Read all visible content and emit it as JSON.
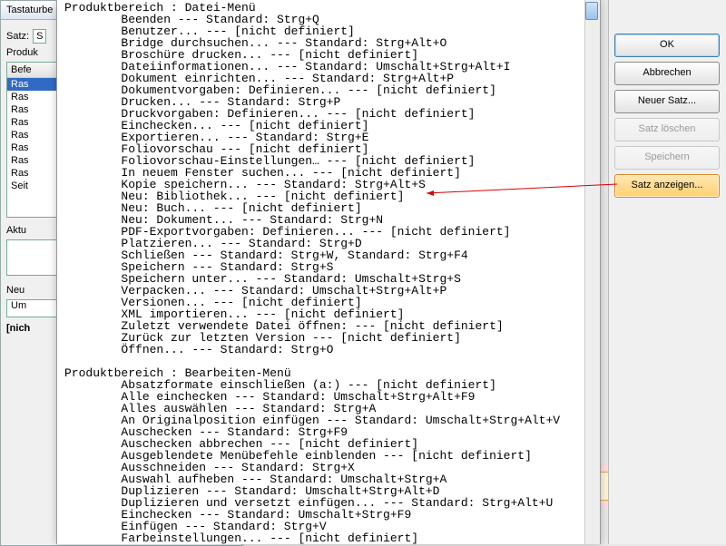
{
  "bg": {
    "title": "Tastaturbe",
    "satz_label": "Satz:",
    "satz_value": "S",
    "produkt_label": "Produk",
    "list_header": "Befe",
    "list_items": [
      "Ras",
      "Ras",
      "Ras",
      "Ras",
      "Ras",
      "Ras",
      "Ras",
      "Ras",
      "Seit"
    ],
    "aktu_label": "Aktu",
    "neu_label": "Neu",
    "um_value": "Um",
    "nicht": "[nich"
  },
  "sections": [
    {
      "title": "Produktbereich : Datei-Menü",
      "items": [
        "Beenden --- Standard: Strg+Q",
        "Benutzer... --- [nicht definiert]",
        "Bridge durchsuchen... --- Standard: Strg+Alt+O",
        "Broschüre drucken... --- [nicht definiert]",
        "Dateiinformationen... --- Standard: Umschalt+Strg+Alt+I",
        "Dokument einrichten... --- Standard: Strg+Alt+P",
        "Dokumentvorgaben: Definieren... --- [nicht definiert]",
        "Drucken... --- Standard: Strg+P",
        "Druckvorgaben: Definieren... --- [nicht definiert]",
        "Einchecken... --- [nicht definiert]",
        "Exportieren... --- Standard: Strg+E",
        "Foliovorschau --- [nicht definiert]",
        "Foliovorschau-Einstellungen… --- [nicht definiert]",
        "In neuem Fenster suchen... --- [nicht definiert]",
        "Kopie speichern... --- Standard: Strg+Alt+S",
        "Neu: Bibliothek... --- [nicht definiert]",
        "Neu: Buch... --- [nicht definiert]",
        "Neu: Dokument... --- Standard: Strg+N",
        "PDF-Exportvorgaben: Definieren... --- [nicht definiert]",
        "Platzieren... --- Standard: Strg+D",
        "Schließen --- Standard: Strg+W, Standard: Strg+F4",
        "Speichern --- Standard: Strg+S",
        "Speichern unter... --- Standard: Umschalt+Strg+S",
        "Verpacken... --- Standard: Umschalt+Strg+Alt+P",
        "Versionen... --- [nicht definiert]",
        "XML importieren... --- [nicht definiert]",
        "Zuletzt verwendete Datei öffnen: --- [nicht definiert]",
        "Zurück zur letzten Version --- [nicht definiert]",
        "Öffnen... --- Standard: Strg+O"
      ]
    },
    {
      "title": "Produktbereich : Bearbeiten-Menü",
      "items": [
        "Absatzformate einschließen (a:) --- [nicht definiert]",
        "Alle einchecken --- Standard: Umschalt+Strg+Alt+F9",
        "Alles auswählen --- Standard: Strg+A",
        "An Originalposition einfügen --- Standard: Umschalt+Strg+Alt+V",
        "Auschecken --- Standard: Strg+F9",
        "Auschecken abbrechen --- [nicht definiert]",
        "Ausgeblendete Menübefehle einblenden --- [nicht definiert]",
        "Ausschneiden --- Standard: Strg+X",
        "Auswahl aufheben --- Standard: Umschalt+Strg+A",
        "Duplizieren --- Standard: Umschalt+Strg+Alt+D",
        "Duplizieren und versetzt einfügen... --- Standard: Strg+Alt+U",
        "Einchecken --- Standard: Umschalt+Strg+F9",
        "Einfügen --- Standard: Strg+V",
        "Farbeinstellungen... --- [nicht definiert]"
      ]
    }
  ],
  "panel": {
    "ok": "OK",
    "abbrechen": "Abbrechen",
    "neuer_satz": "Neuer Satz...",
    "satz_loeschen": "Satz löschen",
    "speichern": "Speichern",
    "satz_anzeigen": "Satz anzeigen..."
  }
}
